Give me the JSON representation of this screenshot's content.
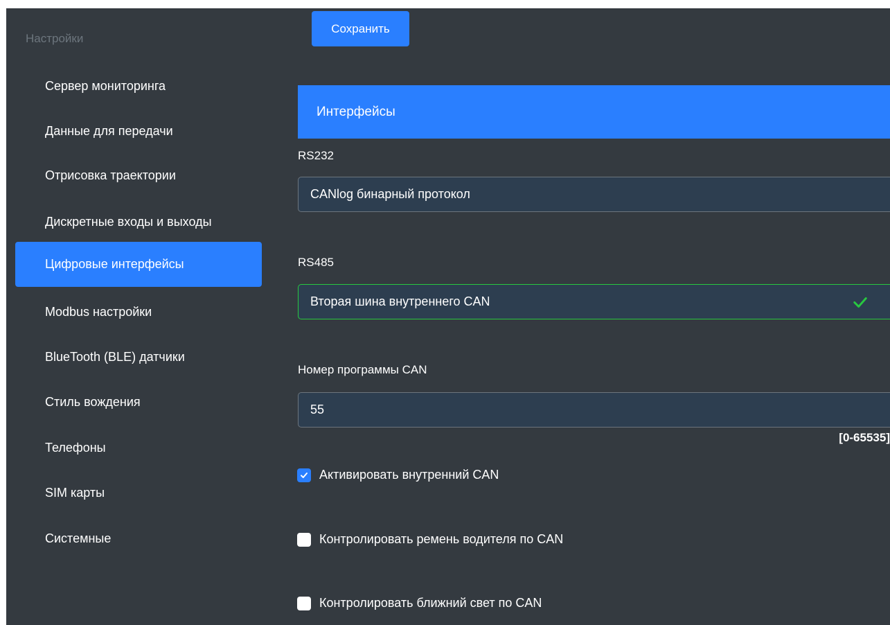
{
  "sidebar": {
    "title": "Настройки",
    "items": [
      {
        "label": "Сервер мониторинга"
      },
      {
        "label": "Данные для передачи"
      },
      {
        "label": "Отрисовка траектории"
      },
      {
        "label": "Дискретные входы и выходы"
      },
      {
        "label": "Цифровые интерфейсы",
        "active": true
      },
      {
        "label": "Modbus настройки"
      },
      {
        "label": "BlueTooth (BLE) датчики"
      },
      {
        "label": "Стиль вождения"
      },
      {
        "label": "Телефоны"
      },
      {
        "label": "SIM карты"
      },
      {
        "label": "Системные"
      }
    ]
  },
  "toolbar": {
    "save_label": "Сохранить"
  },
  "section": {
    "title": "Интерфейсы"
  },
  "rs232": {
    "label": "RS232",
    "value": "CANlog бинарный протокол"
  },
  "rs485": {
    "label": "RS485",
    "value": "Вторая шина внутреннего CAN",
    "status_icon": "check-icon"
  },
  "can_program": {
    "label": "Номер программы CAN",
    "value": "55",
    "range": "[0-65535]"
  },
  "checkboxes": [
    {
      "label": "Активировать внутренний CAN",
      "checked": true
    },
    {
      "label": "Контролировать ремень водителя по CAN",
      "checked": false
    },
    {
      "label": "Контролировать ближний свет по CAN",
      "checked": false
    }
  ],
  "colors": {
    "background": "#343a40",
    "accent": "#2a7fff",
    "valid": "#28c840",
    "muted": "#6c757d"
  }
}
